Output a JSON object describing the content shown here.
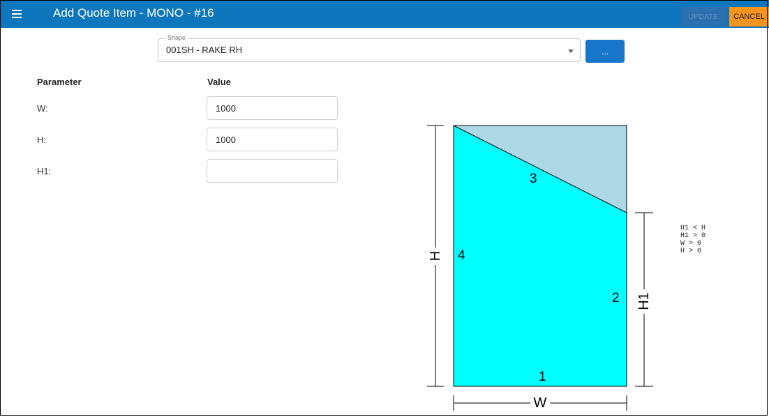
{
  "appbar": {
    "title": "Add Quote Item - MONO - #16",
    "update_label": "UPDATE",
    "cancel_label": "CANCEL",
    "bg_color": "#0d76bd",
    "cancel_color": "#f7941d",
    "menu_icon": "hamburger-menu-icon"
  },
  "shape": {
    "legend": "Shape",
    "value": "001SH - RAKE RH",
    "more_label": "..."
  },
  "params": {
    "col_param": "Parameter",
    "col_value": "Value",
    "rows": [
      {
        "label": "W:",
        "value": "1000"
      },
      {
        "label": "H:",
        "value": "1000"
      },
      {
        "label": "H1:",
        "value": ""
      }
    ]
  },
  "diagram": {
    "fill_color": "#00ffff",
    "cut_color": "#add8e6",
    "side_labels": [
      "1",
      "2",
      "3",
      "4"
    ],
    "dim_w": "W",
    "dim_h": "H",
    "dim_h1": "H1",
    "constraints": [
      "H1 < H",
      "H1 > 0",
      "W > 0",
      "H > 0"
    ]
  }
}
